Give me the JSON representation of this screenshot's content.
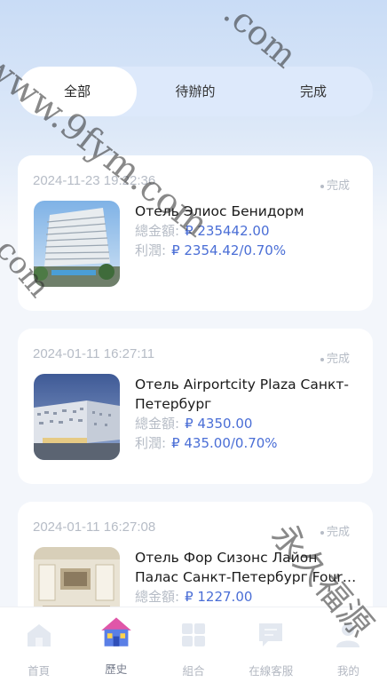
{
  "tabs": [
    {
      "label": "全部",
      "active": true
    },
    {
      "label": "待辦的",
      "active": false
    },
    {
      "label": "完成",
      "active": false
    }
  ],
  "orders": [
    {
      "time": "2024-11-23 19:22:36",
      "status": "完成",
      "hotel_name": "Отель Элиос Бенидорм",
      "total_label": "總金額:",
      "total_value": "₽ 235442.00",
      "profit_label": "利潤:",
      "profit_value": "₽ 2354.42/0.70%"
    },
    {
      "time": "2024-01-11 16:27:11",
      "status": "完成",
      "hotel_name": "Отель Airportcity Plaza Санкт-Петербург",
      "total_label": "總金額:",
      "total_value": "₽ 4350.00",
      "profit_label": "利潤:",
      "profit_value": "₽ 435.00/0.70%"
    },
    {
      "time": "2024-01-11 16:27:08",
      "status": "完成",
      "hotel_name": "Отель Фор Сизонс Лайон Палас Санкт-Петербург Four Seasons",
      "total_label": "總金額:",
      "total_value": "₽ 1227.00",
      "profit_label": "利潤:",
      "profit_value": ""
    }
  ],
  "nav": [
    {
      "label": "首頁",
      "icon": "home-icon"
    },
    {
      "label": "歷史",
      "icon": "history-house-icon",
      "active": true
    },
    {
      "label": "組合",
      "icon": "grid-icon"
    },
    {
      "label": "在線客服",
      "icon": "chat-icon"
    },
    {
      "label": "我的",
      "icon": "user-icon"
    }
  ],
  "watermarks": [
    "www.9fym.com",
    ".com",
    "com",
    "永久福源"
  ],
  "colors": {
    "accent": "#4a6ed6",
    "muted": "#b6bcc6",
    "tab_bg": "#dde9fb"
  }
}
